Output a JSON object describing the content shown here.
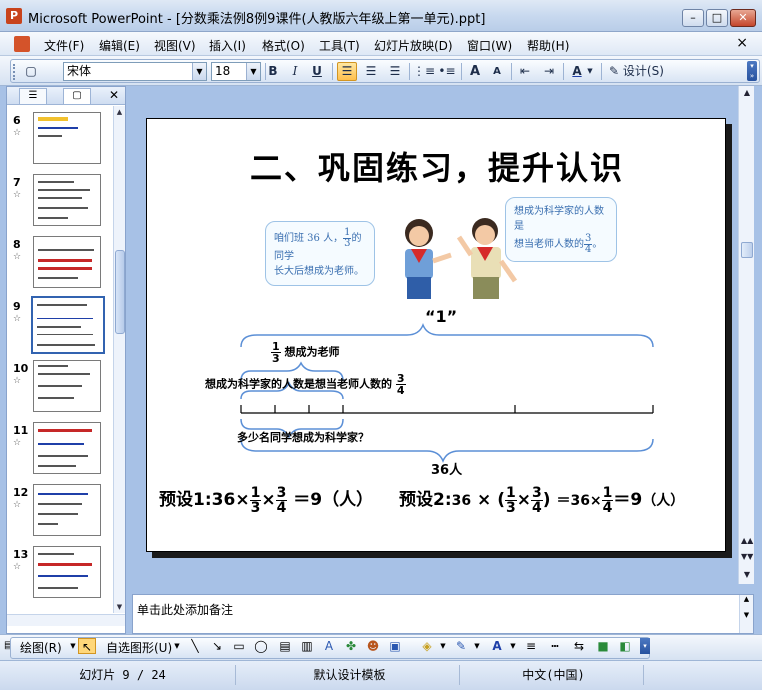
{
  "window": {
    "title": "Microsoft PowerPoint - [分数乘法例8例9课件(人教版六年级上第一单元).ppt]",
    "app_icon": "P",
    "controls": [
      "–",
      "□",
      "✕"
    ]
  },
  "menu": {
    "items": [
      "文件(F)",
      "编辑(E)",
      "视图(V)",
      "插入(I)",
      "格式(O)",
      "工具(T)",
      "幻灯片放映(D)",
      "窗口(W)",
      "帮助(H)"
    ],
    "close": "×"
  },
  "toolbar": {
    "font_name": "宋体",
    "font_size": "18",
    "bold": "B",
    "italic": "I",
    "underline": "U",
    "grow": "A",
    "shrink": "A",
    "font_color": "A",
    "design": "设计(S)"
  },
  "panel": {
    "tab_outline": "☰",
    "tab_slides": "▢",
    "close": "✕"
  },
  "thumbnails": [
    {
      "num": "6",
      "selected": false
    },
    {
      "num": "7",
      "selected": false
    },
    {
      "num": "8",
      "selected": false
    },
    {
      "num": "9",
      "selected": true
    },
    {
      "num": "10",
      "selected": false
    },
    {
      "num": "11",
      "selected": false
    },
    {
      "num": "12",
      "selected": false
    },
    {
      "num": "13",
      "selected": false
    }
  ],
  "slide": {
    "title": "二、巩固练习，提升认识",
    "bubble_left": {
      "pre": "咱们班 36 人，",
      "n": "1",
      "d": "3",
      "post": "的同学",
      "line2": "长大后想成为老师。"
    },
    "bubble_right": {
      "line1": "想成为科学家的人数是",
      "pre2": "想当老师人数的",
      "n": "3",
      "d": "4",
      "post2": "。"
    },
    "quote_one": "“1”",
    "teacher": {
      "n": "1",
      "d": "3",
      "text": "想成为老师"
    },
    "scientist": {
      "text": "想成为科学家的人数是想当老师人数的",
      "n": "3",
      "d": "4"
    },
    "question": "多少名同学想成为科学家？",
    "total": "36人",
    "eq1": {
      "label": "预设1:",
      "a": "36",
      "times": "×",
      "f1n": "1",
      "f1d": "3",
      "f2n": "3",
      "f2d": "4",
      "eq": "＝9",
      "unit": "（人）"
    },
    "eq2": {
      "label": "预设2:",
      "a": "36",
      "times": "×",
      "lp": "(",
      "f1n": "1",
      "f1d": "3",
      "f2n": "3",
      "f2d": "4",
      "rp": ")",
      "eq_mid": "＝36×",
      "f3n": "1",
      "f3d": "4",
      "eq": "＝9",
      "unit": "（人）"
    }
  },
  "notes": {
    "placeholder": "单击此处添加备注"
  },
  "drawbar": {
    "draw": "绘图(R)",
    "autoshapes": "自选图形(U)"
  },
  "status": {
    "slide": "幻灯片 9 / 24",
    "template": "默认设计模板",
    "language": "中文(中国)"
  }
}
